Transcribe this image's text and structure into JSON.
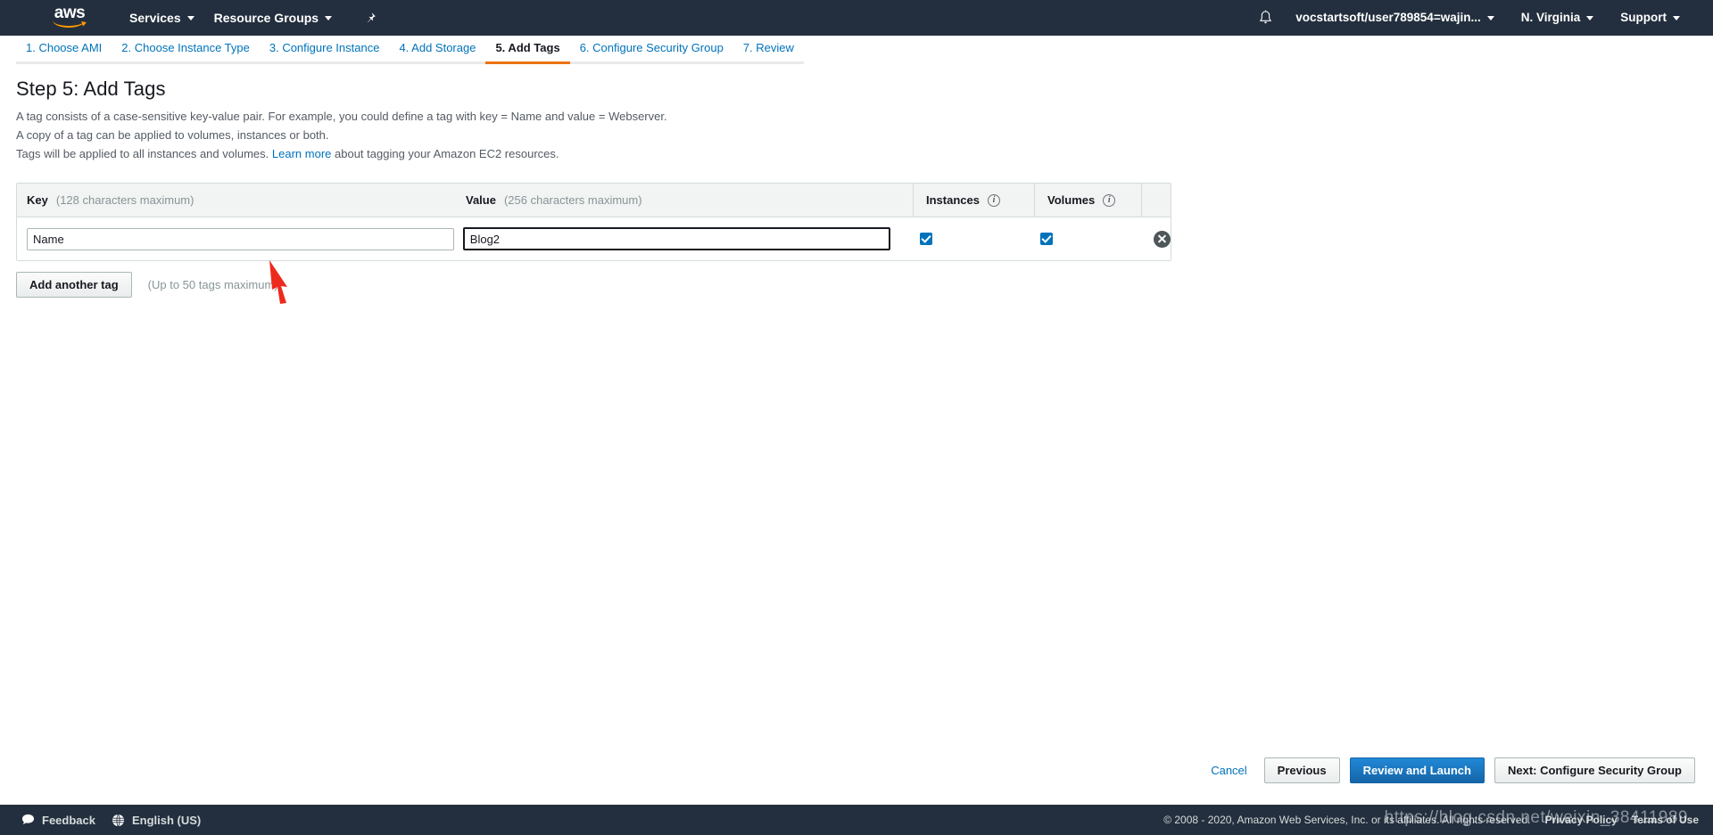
{
  "topnav": {
    "logo_alt": "aws",
    "services_label": "Services",
    "resource_groups_label": "Resource Groups",
    "pin_icon": "pin-icon",
    "bell_icon": "bell-icon",
    "account_label": "vocstartsoft/user789854=wajin...",
    "region_label": "N. Virginia",
    "support_label": "Support"
  },
  "wizard": {
    "tabs": [
      {
        "label": "1. Choose AMI",
        "active": false
      },
      {
        "label": "2. Choose Instance Type",
        "active": false
      },
      {
        "label": "3. Configure Instance",
        "active": false
      },
      {
        "label": "4. Add Storage",
        "active": false
      },
      {
        "label": "5. Add Tags",
        "active": true
      },
      {
        "label": "6. Configure Security Group",
        "active": false
      },
      {
        "label": "7. Review",
        "active": false
      }
    ]
  },
  "page": {
    "title": "Step 5: Add Tags",
    "desc_line1": "A tag consists of a case-sensitive key-value pair. For example, you could define a tag with key = Name and value = Webserver.",
    "desc_line2": "A copy of a tag can be applied to volumes, instances or both.",
    "desc_line3_pre": "Tags will be applied to all instances and volumes.",
    "desc_link": "Learn more",
    "desc_line3_post": "about tagging your Amazon EC2 resources."
  },
  "table": {
    "headers": {
      "key_label": "Key",
      "key_hint": "(128 characters maximum)",
      "value_label": "Value",
      "value_hint": "(256 characters maximum)",
      "instances_label": "Instances",
      "volumes_label": "Volumes",
      "info_glyph": "i"
    },
    "rows": [
      {
        "key_value": "Name",
        "key_placeholder": "",
        "value_value": "Blog2",
        "value_placeholder": "",
        "value_focused": true,
        "instances_checked": true,
        "volumes_checked": true,
        "delete_icon": "remove-circle-icon"
      }
    ]
  },
  "add_tag": {
    "button_label": "Add another tag",
    "hint": "(Up to 50 tags maximum)"
  },
  "actions": {
    "cancel_label": "Cancel",
    "previous_label": "Previous",
    "review_label": "Review and Launch",
    "next_label": "Next: Configure Security Group"
  },
  "footer": {
    "feedback_label": "Feedback",
    "feedback_icon": "speech-bubble-icon",
    "language_label": "English (US)",
    "language_icon": "globe-icon",
    "copyright": "© 2008 - 2020, Amazon Web Services, Inc. or its affiliates. All rights reserved.",
    "privacy_label": "Privacy Policy",
    "terms_label": "Terms of Use"
  },
  "annotations": {
    "watermark": "https://blog.csdn.net/weixin_38411989",
    "arrow_icon": "red-arrow-annotation"
  },
  "colors": {
    "nav_bg": "#232f3e",
    "accent_orange": "#ec7211",
    "link_blue": "#0073bb",
    "primary_button": "#1565a8",
    "checkbox_blue": "#0073bb"
  }
}
